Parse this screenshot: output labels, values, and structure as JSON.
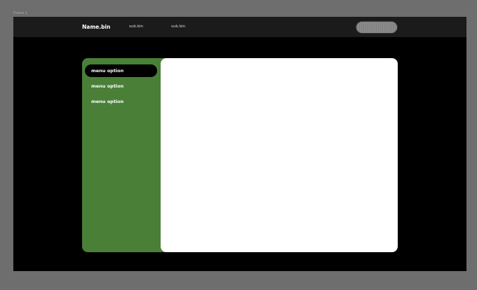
{
  "frame_label": "Frame 1",
  "header": {
    "brand": "Name.bin",
    "nav": [
      "sub.bin",
      "sub.bin"
    ]
  },
  "sidebar": {
    "items": [
      {
        "label": "menu option",
        "active": true
      },
      {
        "label": "menu option",
        "active": false
      },
      {
        "label": "menu option",
        "active": false
      }
    ]
  },
  "colors": {
    "sidebar": "#4a7f37",
    "header": "#1b1b1b",
    "background": "#000000"
  }
}
